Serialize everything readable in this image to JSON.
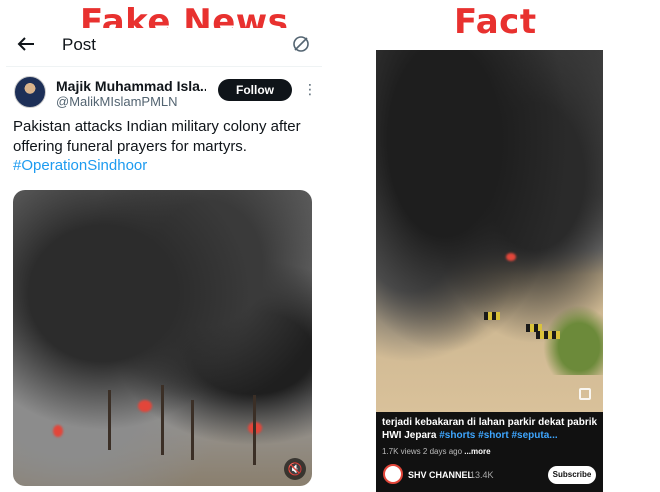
{
  "labels": {
    "fake": "Fake News",
    "fact": "Fact"
  },
  "tweet": {
    "header_title": "Post",
    "user_name": "Majik Muhammad Isla...",
    "handle": "@MalikMIslamPMLN",
    "follow_label": "Follow",
    "text": "Pakistan attacks Indian military colony after offering funeral prayers for martyrs.",
    "hashtag": "#OperationSindhoor",
    "media_desc": "video of black smoke and fire",
    "icons": [
      "back-arrow-icon",
      "sync-icon",
      "more-dots-icon",
      "mute-icon"
    ]
  },
  "short": {
    "caption_text": "terjadi kebakaran di lahan parkir dekat pabrik HWI Jepara ",
    "caption_tags": "#shorts #short #seputa...",
    "views": "1.7K views",
    "age": "2 days ago",
    "more_label": "...more",
    "channel_name": "SHV CHANNEL",
    "subscribers": "13.4K",
    "subscribe_label": "Subscribe",
    "icons": [
      "expand-icon"
    ]
  },
  "colors": {
    "label_red": "#e8312f",
    "link_blue": "#1d9bf0",
    "yt_link_blue": "#3ea6ff",
    "follow_bg": "#0f1419"
  }
}
